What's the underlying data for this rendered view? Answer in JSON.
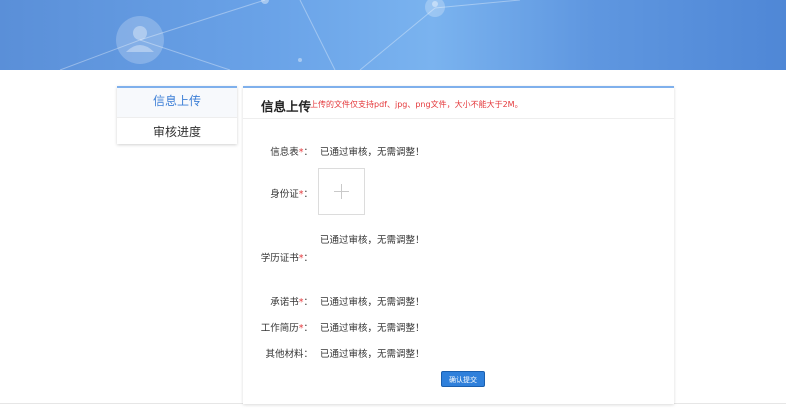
{
  "sidebar": {
    "items": [
      {
        "label": "信息上传",
        "active": true
      },
      {
        "label": "审核进度",
        "active": false
      }
    ]
  },
  "panel": {
    "title": "信息上传",
    "note": "上传的文件仅支持pdf、jpg、png文件，大小不能大于2M。"
  },
  "form": {
    "info_form": {
      "label": "信息表",
      "required": "*",
      "colon": "：",
      "status": "已通过审核，无需调整！"
    },
    "id_card": {
      "label": "身份证",
      "required": "*",
      "colon": "：",
      "upload_icon": "plus-icon"
    },
    "diploma": {
      "label": "学历证书",
      "required": "*",
      "colon": "：",
      "status": "已通过审核，无需调整！"
    },
    "commitment": {
      "label": "承诺书",
      "required": "*",
      "colon": "：",
      "status": "已通过审核，无需调整！"
    },
    "resume": {
      "label": "工作简历",
      "required": "*",
      "colon": "：",
      "status": "已通过审核，无需调整！"
    },
    "other": {
      "label": "其他材料",
      "colon": "：",
      "status": "已通过审核，无需调整！"
    }
  },
  "submit_label": "确认提交",
  "colors": {
    "accent": "#3d7fd6",
    "required": "#e4393c",
    "button": "#2f80db",
    "banner": "#5a8fd8"
  }
}
